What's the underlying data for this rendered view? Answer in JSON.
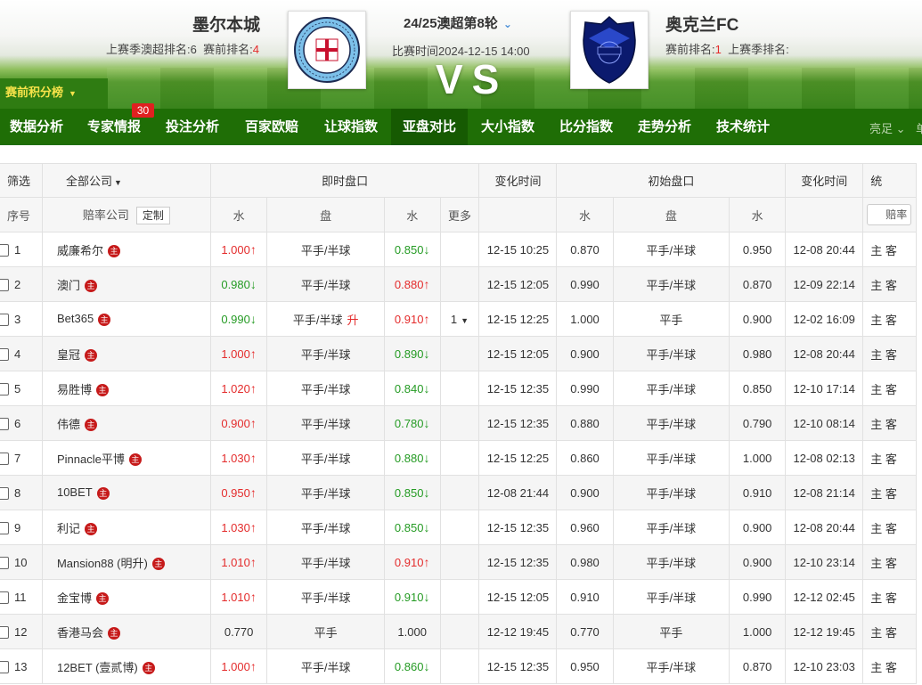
{
  "home": {
    "name": "墨尔本城",
    "last_season_label": "上赛季澳超排名:",
    "last_season_rank": "6",
    "pre_label": "赛前排名:",
    "pre_rank": "4"
  },
  "away": {
    "name": "奥克兰FC",
    "pre_label": "赛前排名:",
    "pre_rank": "1",
    "last_season_label": "上赛季排名:",
    "last_season_rank": ""
  },
  "match": {
    "title": "24/25澳超第8轮",
    "time": "比赛时间2024-12-15 14:00",
    "vs": "VS"
  },
  "points_tab": "赛前积分榜",
  "nav": {
    "items": [
      "数据分析",
      "专家情报",
      "投注分析",
      "百家欧赔",
      "让球指数",
      "亚盘对比",
      "大小指数",
      "比分指数",
      "走势分析",
      "技术统计"
    ],
    "active": "亚盘对比",
    "badge": "30",
    "theme": "亮足",
    "extra": "单"
  },
  "table": {
    "filter": "筛选",
    "company_select": "全部公司",
    "live_group": "即时盘口",
    "change_time": "变化时间",
    "initial_group": "初始盘口",
    "stats_partial": "统",
    "seq_header": "序号",
    "company_header": "赔率公司",
    "custom_btn": "定制",
    "water": "水",
    "handicap": "盘",
    "more": "更多",
    "odds_btn": "赔率",
    "home_away": "主 客",
    "host_mark": "主",
    "rows": [
      {
        "no": "1",
        "company": "威廉希尔",
        "lw1": "1.000",
        "lw1d": "up",
        "lh": "平手/半球",
        "lhx": "",
        "lw2": "0.850",
        "lw2d": "down",
        "more": "",
        "t1": "12-15 10:25",
        "iw1": "0.870",
        "ih": "平手/半球",
        "iw2": "0.950",
        "t2": "12-08 20:44"
      },
      {
        "no": "2",
        "company": "澳门",
        "lw1": "0.980",
        "lw1d": "down",
        "lh": "平手/半球",
        "lhx": "",
        "lw2": "0.880",
        "lw2d": "up",
        "more": "",
        "t1": "12-15 12:05",
        "iw1": "0.990",
        "ih": "平手/半球",
        "iw2": "0.870",
        "t2": "12-09 22:14"
      },
      {
        "no": "3",
        "company": "Bet365",
        "lw1": "0.990",
        "lw1d": "down",
        "lh": "平手/半球",
        "lhx": "升",
        "lw2": "0.910",
        "lw2d": "up",
        "more": "1",
        "t1": "12-15 12:25",
        "iw1": "1.000",
        "ih": "平手",
        "iw2": "0.900",
        "t2": "12-02 16:09"
      },
      {
        "no": "4",
        "company": "皇冠",
        "lw1": "1.000",
        "lw1d": "up",
        "lh": "平手/半球",
        "lhx": "",
        "lw2": "0.890",
        "lw2d": "down",
        "more": "",
        "t1": "12-15 12:05",
        "iw1": "0.900",
        "ih": "平手/半球",
        "iw2": "0.980",
        "t2": "12-08 20:44"
      },
      {
        "no": "5",
        "company": "易胜博",
        "lw1": "1.020",
        "lw1d": "up",
        "lh": "平手/半球",
        "lhx": "",
        "lw2": "0.840",
        "lw2d": "down",
        "more": "",
        "t1": "12-15 12:35",
        "iw1": "0.990",
        "ih": "平手/半球",
        "iw2": "0.850",
        "t2": "12-10 17:14"
      },
      {
        "no": "6",
        "company": "伟德",
        "lw1": "0.900",
        "lw1d": "up",
        "lh": "平手/半球",
        "lhx": "",
        "lw2": "0.780",
        "lw2d": "down",
        "more": "",
        "t1": "12-15 12:35",
        "iw1": "0.880",
        "ih": "平手/半球",
        "iw2": "0.790",
        "t2": "12-10 08:14"
      },
      {
        "no": "7",
        "company": "Pinnacle平博",
        "lw1": "1.030",
        "lw1d": "up",
        "lh": "平手/半球",
        "lhx": "",
        "lw2": "0.880",
        "lw2d": "down",
        "more": "",
        "t1": "12-15 12:25",
        "iw1": "0.860",
        "ih": "平手/半球",
        "iw2": "1.000",
        "t2": "12-08 02:13"
      },
      {
        "no": "8",
        "company": "10BET",
        "lw1": "0.950",
        "lw1d": "up",
        "lh": "平手/半球",
        "lhx": "",
        "lw2": "0.850",
        "lw2d": "down",
        "more": "",
        "t1": "12-08 21:44",
        "iw1": "0.900",
        "ih": "平手/半球",
        "iw2": "0.910",
        "t2": "12-08 21:14"
      },
      {
        "no": "9",
        "company": "利记",
        "lw1": "1.030",
        "lw1d": "up",
        "lh": "平手/半球",
        "lhx": "",
        "lw2": "0.850",
        "lw2d": "down",
        "more": "",
        "t1": "12-15 12:35",
        "iw1": "0.960",
        "ih": "平手/半球",
        "iw2": "0.900",
        "t2": "12-08 20:44"
      },
      {
        "no": "10",
        "company": "Mansion88 (明升)",
        "lw1": "1.010",
        "lw1d": "up",
        "lh": "平手/半球",
        "lhx": "",
        "lw2": "0.910",
        "lw2d": "up",
        "more": "",
        "t1": "12-15 12:35",
        "iw1": "0.980",
        "ih": "平手/半球",
        "iw2": "0.900",
        "t2": "12-10 23:14"
      },
      {
        "no": "11",
        "company": "金宝博",
        "lw1": "1.010",
        "lw1d": "up",
        "lh": "平手/半球",
        "lhx": "",
        "lw2": "0.910",
        "lw2d": "down",
        "more": "",
        "t1": "12-15 12:05",
        "iw1": "0.910",
        "ih": "平手/半球",
        "iw2": "0.990",
        "t2": "12-12 02:45"
      },
      {
        "no": "12",
        "company": "香港马会",
        "lw1": "0.770",
        "lw1d": "",
        "lh": "平手",
        "lhx": "",
        "lw2": "1.000",
        "lw2d": "",
        "more": "",
        "t1": "12-12 19:45",
        "iw1": "0.770",
        "ih": "平手",
        "iw2": "1.000",
        "t2": "12-12 19:45"
      },
      {
        "no": "13",
        "company": "12BET (壹贰博)",
        "lw1": "1.000",
        "lw1d": "up",
        "lh": "平手/半球",
        "lhx": "",
        "lw2": "0.860",
        "lw2d": "down",
        "more": "",
        "t1": "12-15 12:35",
        "iw1": "0.950",
        "ih": "平手/半球",
        "iw2": "0.870",
        "t2": "12-10 23:03"
      }
    ]
  },
  "colors": {
    "nav_green": "#1f6e06",
    "up_red": "#e42c2c",
    "down_green": "#259b24",
    "badge_red": "#e02020",
    "points_tab_text": "#f7e34a"
  }
}
